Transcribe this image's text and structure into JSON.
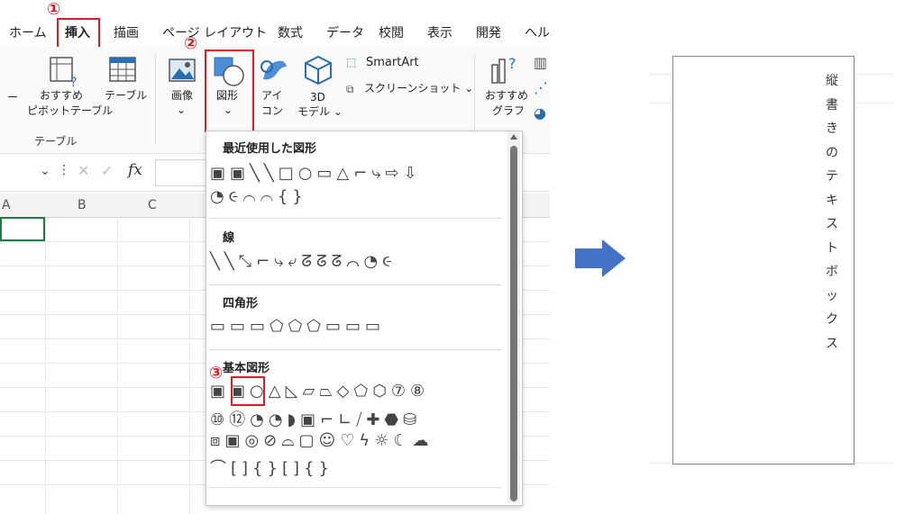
{
  "ribbon_tabs": [
    "ホーム",
    "挿入",
    "描画",
    "ページ レイアウト",
    "数式",
    "データ",
    "校閲",
    "表示",
    "開発",
    "ヘル"
  ],
  "markers": {
    "one": "①",
    "two": "②",
    "three": "③"
  },
  "ribbon": {
    "dash": "ー",
    "pivot_label_1": "おすすめ",
    "pivot_label_2": "ピボットテーブル",
    "table_label": "テーブル",
    "group_table": "テーブル",
    "image_label": "画像",
    "shape_label": "図形",
    "icon_label_1": "アイ",
    "icon_label_2": "コン",
    "model_label_1": "3D",
    "model_label_2": "モデル ⌄",
    "smartart": "SmartArt",
    "screenshot": "スクリーンショット ⌄",
    "recommended_chart_1": "おすすめ",
    "recommended_chart_2": "グラフ"
  },
  "formula_bar": {
    "fx": "fx"
  },
  "columns": [
    "A",
    "B",
    "C"
  ],
  "shapes_menu": {
    "recent_title": "最近使用した図形",
    "recent_row1": "▣▣╲╲□○▭△⌐⤷⇨⇩",
    "recent_row2": "◔૯⌒⌒{}",
    "lines_title": "線",
    "lines_row": "╲╲⤡⌐⤷⤶ᘔᘔᘔ⌒◔૯",
    "rect_title": "四角形",
    "rect_row": "▭▭▭⬠⬠⬠▭▭▭",
    "basic_title": "基本図形",
    "basic_row1": "▣▣○△◺▱⏢◇⬠⬡⑦⑧",
    "basic_row2": "⑩⑫◔◔◗▣⌐∟⧸✚⬣⛁",
    "basic_row3": "⧈▣◎⊘⌓▢☺♡ϟ☼☾☁",
    "basic_row4": "⌒[]{}[]{}"
  },
  "textbox": {
    "chars": [
      "縦",
      "書",
      "き",
      "の",
      "テ",
      "キ",
      "ス",
      "ト",
      "ボ",
      "ッ",
      "ク",
      "ス"
    ]
  },
  "colors": {
    "accent": "#1e7b46",
    "highlight": "#e01b24",
    "arrow": "#4472c4"
  }
}
